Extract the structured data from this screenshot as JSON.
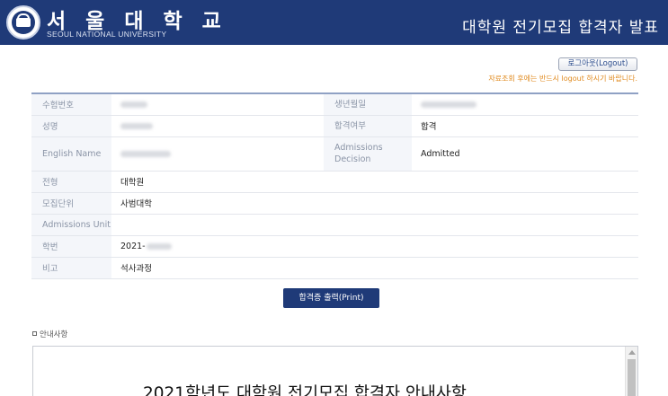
{
  "header": {
    "logo_kr": "서 울 대 학 교",
    "logo_en": "SEOUL NATIONAL UNIVERSITY",
    "title": "대학원 전기모집 합격자 발표"
  },
  "session": {
    "logout_label": "로그아웃(Logout)",
    "logout_note": "자료조회 후에는 반드시 logout 하시기 바랍니다."
  },
  "applicant": {
    "exam_no_label": "수험번호",
    "birth_label": "생년월일",
    "name_label": "성명",
    "result_label": "합격여부",
    "result_value": "합격",
    "english_name_label": "English Name",
    "admissions_decision_label": "Admissions Decision",
    "admissions_decision_value": "Admitted",
    "track_label": "전형",
    "track_value": "대학원",
    "unit_label": "모집단위",
    "unit_value": "사범대학",
    "admissions_unit_label": "Admissions Unit",
    "admissions_unit_value": "",
    "student_id_label": "학번",
    "student_id_prefix": "2021-",
    "remark_label": "비고",
    "remark_value": "석사과정"
  },
  "print_label": "합격증 출력(Print)",
  "notice": {
    "label": "안내사항",
    "heading": "2021학년도 대학원 전기모집 합격자 안내사항"
  }
}
